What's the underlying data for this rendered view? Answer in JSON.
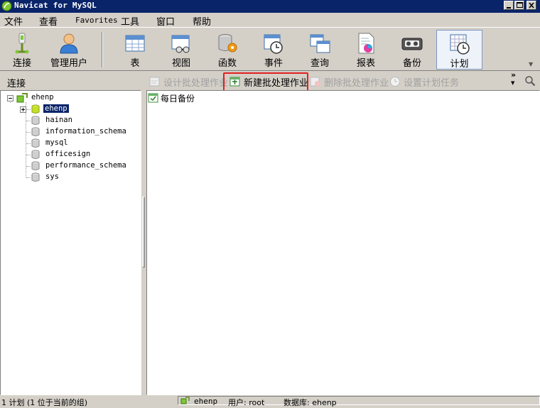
{
  "window": {
    "title": "Navicat for MySQL"
  },
  "menu": [
    "文件",
    "查看",
    "Favorites",
    "工具",
    "窗口",
    "帮助"
  ],
  "toolbar": [
    {
      "label": "连接",
      "icon": "connection-icon"
    },
    {
      "label": "管理用户",
      "icon": "user-icon"
    },
    {
      "label": "表",
      "icon": "table-icon"
    },
    {
      "label": "视图",
      "icon": "view-icon"
    },
    {
      "label": "函数",
      "icon": "function-icon"
    },
    {
      "label": "事件",
      "icon": "event-icon"
    },
    {
      "label": "查询",
      "icon": "query-icon"
    },
    {
      "label": "报表",
      "icon": "report-icon"
    },
    {
      "label": "备份",
      "icon": "backup-icon"
    },
    {
      "label": "计划",
      "icon": "schedule-icon",
      "active": true
    }
  ],
  "connection_panel_label": "连接",
  "subtoolbar": {
    "design": "设计批处理作业",
    "new": "新建批处理作业",
    "delete": "删除批处理作业",
    "set_task": "设置计划任务"
  },
  "tree": {
    "connection": "ehenp",
    "databases": [
      "ehenp",
      "hainan",
      "information_schema",
      "mysql",
      "officesign",
      "performance_schema",
      "sys"
    ],
    "selected": "ehenp"
  },
  "jobs": [
    "每日备份"
  ],
  "status": {
    "left": "1 计划 (1 位于当前的组)",
    "connection": "ehenp",
    "user_label": "用户: root",
    "db_label": "数据库: ehenp"
  },
  "colors": {
    "titlebar": "#0a246a",
    "highlight_box": "#e02020",
    "selection": "#0a246a"
  }
}
